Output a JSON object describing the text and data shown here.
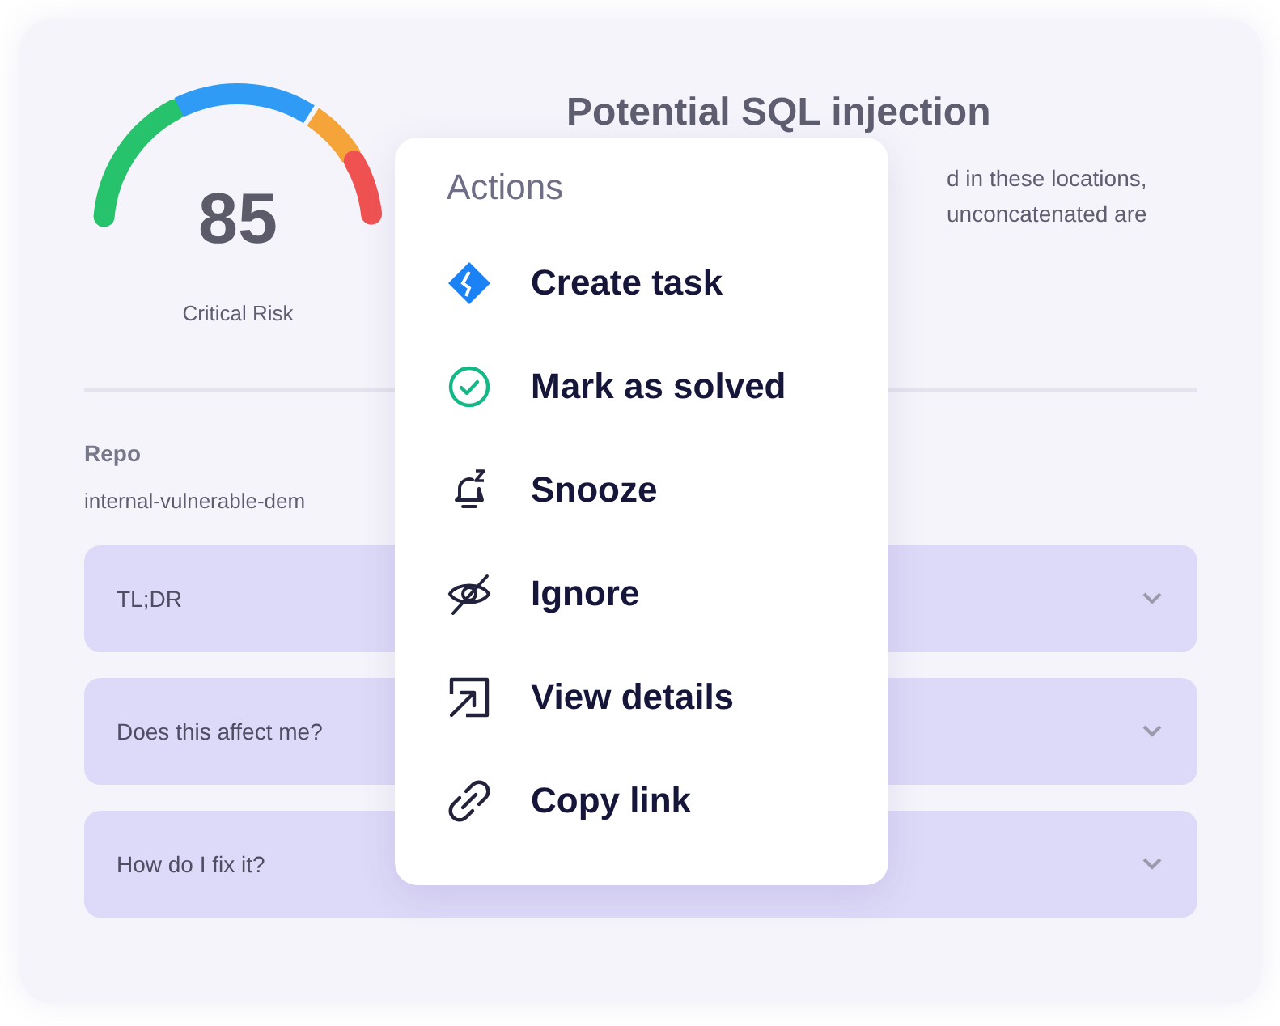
{
  "issue": {
    "score": "85",
    "risk_label": "Critical Risk",
    "title": "Potential SQL injection",
    "description_lines": [
      "d in these locations,",
      "unconcatenated are"
    ],
    "repo": {
      "label": "Repo",
      "value": "internal-vulnerable-dem"
    },
    "sections": [
      {
        "title": "TL;DR"
      },
      {
        "title": "Does this affect me?"
      },
      {
        "title": "How do I fix it?"
      }
    ]
  },
  "menu": {
    "title": "Actions",
    "items": [
      {
        "label": "Create task"
      },
      {
        "label": "Mark as solved"
      },
      {
        "label": "Snooze"
      },
      {
        "label": "Ignore"
      },
      {
        "label": "View details"
      },
      {
        "label": "Copy link"
      }
    ]
  }
}
